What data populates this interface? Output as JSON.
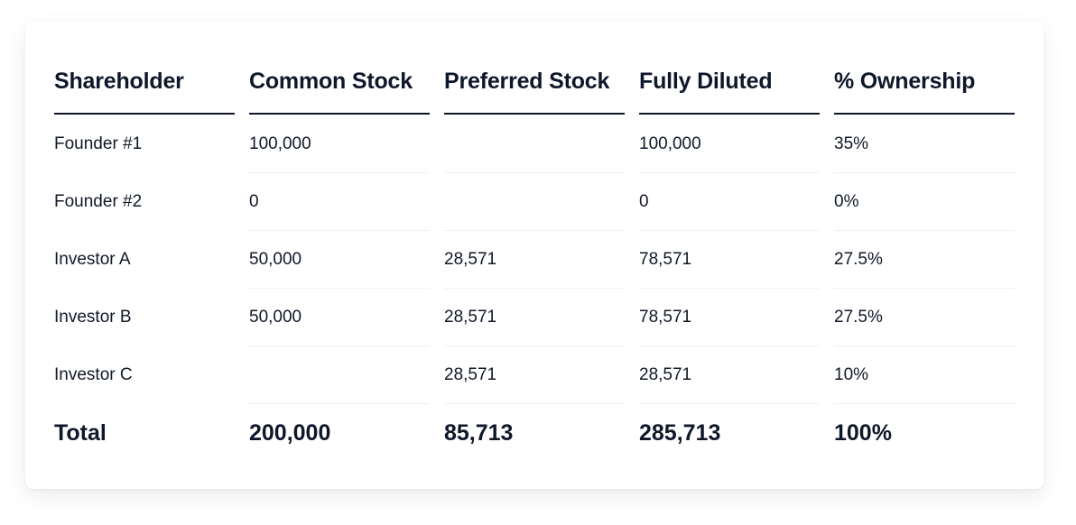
{
  "table": {
    "headers": [
      "Shareholder",
      "Common Stock",
      "Preferred Stock",
      "Fully Diluted",
      "% Ownership"
    ],
    "rows": [
      [
        "Founder #1",
        "100,000",
        "",
        "100,000",
        "35%"
      ],
      [
        "Founder #2",
        "0",
        "",
        "0",
        "0%"
      ],
      [
        "Investor A",
        "50,000",
        "28,571",
        "78,571",
        "27.5%"
      ],
      [
        "Investor B",
        "50,000",
        "28,571",
        "78,571",
        "27.5%"
      ],
      [
        "Investor C",
        "",
        "28,571",
        "28,571",
        "10%"
      ]
    ],
    "total": [
      "Total",
      "200,000",
      "85,713",
      "285,713",
      "100%"
    ]
  },
  "colors": {
    "text": "#0f172a",
    "divider": "#0f172a",
    "row_separator": "#eef0f3"
  }
}
